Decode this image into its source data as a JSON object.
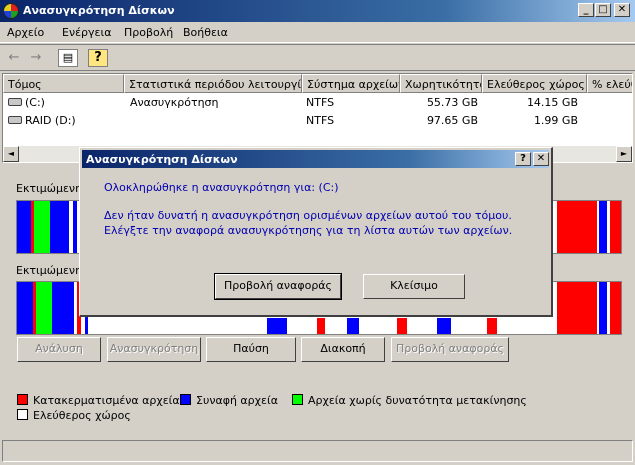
{
  "window": {
    "title": "Ανασυγκρότηση Δίσκων"
  },
  "title_buttons": {
    "minimize": "_",
    "maximize": "□",
    "close": "✕"
  },
  "menu": [
    "Αρχείο",
    "Ενέργεια",
    "Προβολή",
    "Βοήθεια"
  ],
  "toolbar": {
    "back_icon": "←",
    "forward_icon": "→",
    "properties_icon": "▤",
    "help_icon": "?"
  },
  "columns": [
    "Τόμος",
    "Στατιστικά περιόδου λειτουργίας",
    "Σύστημα αρχείων",
    "Χωρητικότητα",
    "Ελεύθερος χώρος",
    "% ελεύθ"
  ],
  "volumes": [
    {
      "name": "(C:)",
      "status": "Ανασυγκρότηση",
      "fs": "NTFS",
      "capacity": "55.73 GB",
      "free": "14.15 GB"
    },
    {
      "name": "RAID (D:)",
      "status": "",
      "fs": "NTFS",
      "capacity": "97.65 GB",
      "free": "1.99 GB"
    }
  ],
  "scroll": {
    "left": "◄",
    "right": "►"
  },
  "analysis": {
    "before_label": "Εκτιμώμενη",
    "after_label": "Εκτιμώμενη"
  },
  "buttons": {
    "analyze": "Ανάλυση",
    "defrag": "Ανασυγκρότηση",
    "pause": "Παύση",
    "stop": "Διακοπή",
    "view_report": "Προβολή αναφοράς"
  },
  "legend": [
    {
      "label": "Κατακερματισμένα αρχεία",
      "color": "#ff0000"
    },
    {
      "label": "Συναφή αρχεία",
      "color": "#0000ff"
    },
    {
      "label": "Αρχεία χωρίς δυνατότητα μετακίνησης",
      "color": "#00ff00"
    },
    {
      "label": "Ελεύθερος χώρος",
      "color": "#ffffff"
    }
  ],
  "dialog": {
    "title": "Ανασυγκρότηση Δίσκων",
    "help": "?",
    "close": "✕",
    "line1": "Ολοκληρώθηκε η ανασυγκρότηση για: (C:)",
    "line2": "Δεν ήταν δυνατή η ανασυγκρότηση ορισμένων αρχείων αυτού του τόμου.",
    "line3": "Ελέγξτε την αναφορά ανασυγκρότησης για τη λίστα αυτών των αρχείων.",
    "view_report": "Προβολή αναφοράς",
    "close_button": "Κλείσιμο"
  }
}
